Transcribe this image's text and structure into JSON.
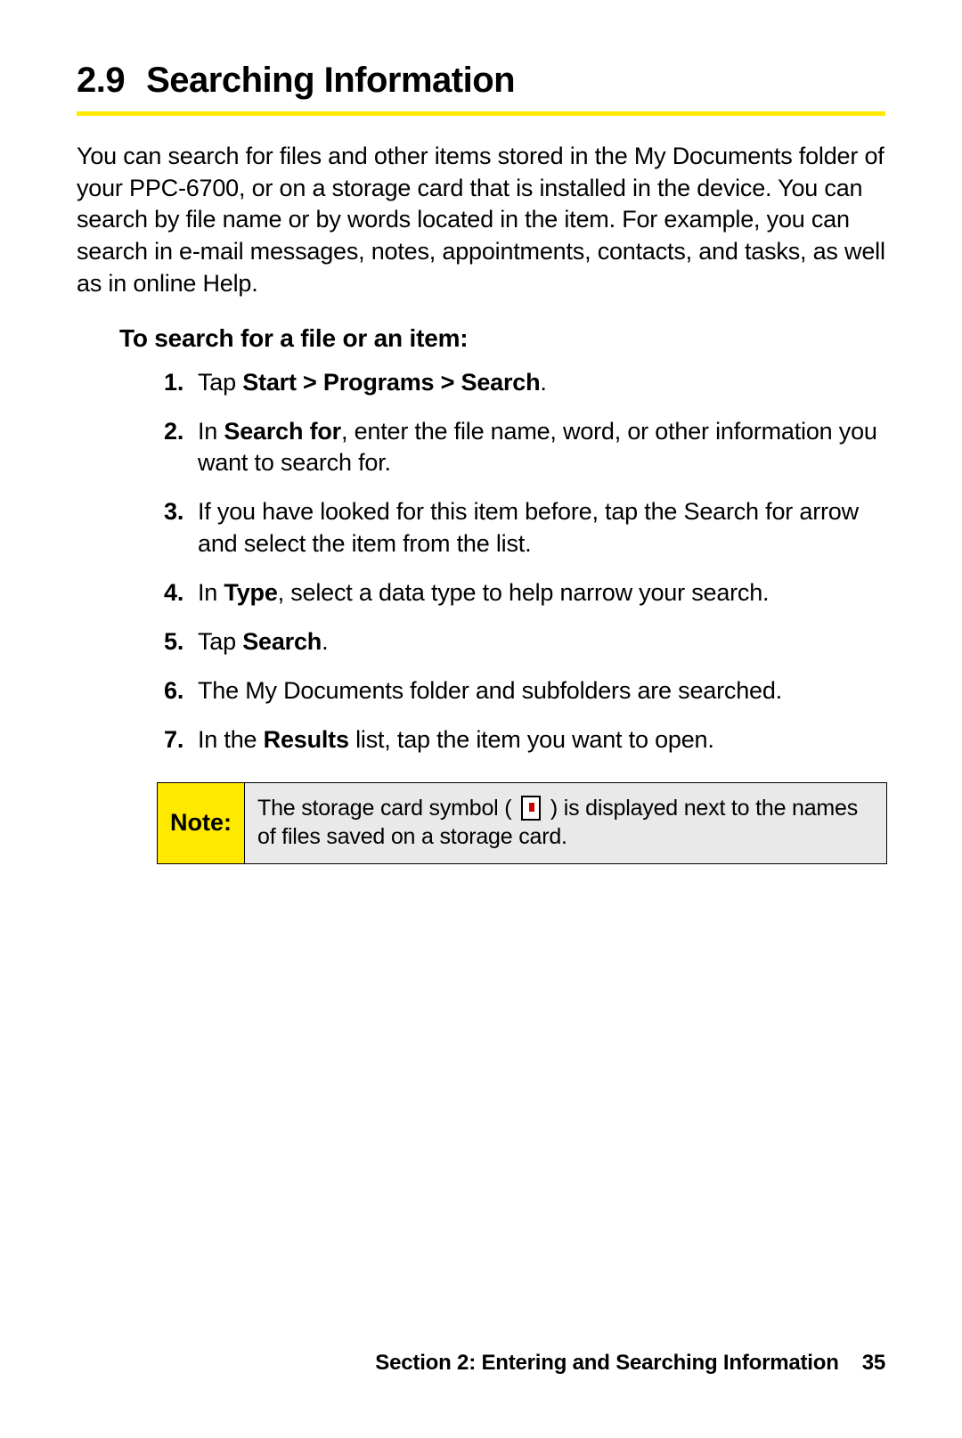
{
  "heading": {
    "number": "2.9",
    "title": "Searching Information"
  },
  "intro": "You can search for files and other items stored in the My Documents folder of your PPC-6700, or on a storage card that is installed in the device. You can search by file name or by words located in the item. For example, you can search in e-mail messages, notes, appointments, contacts, and tasks, as well as in online Help.",
  "subheading": "To search for a file or an item:",
  "steps": {
    "s1_pre": "Tap ",
    "s1_bold": "Start > Programs > Search",
    "s1_post": ".",
    "s2_pre": "In ",
    "s2_bold": "Search for",
    "s2_post": ", enter the file name, word, or other information you want to search for.",
    "s3": "If you have looked for this item before, tap the Search for arrow and select the item from the list.",
    "s4_pre": "In ",
    "s4_bold": "Type",
    "s4_post": ", select a data type to help narrow your search.",
    "s5_pre": "Tap ",
    "s5_bold": "Search",
    "s5_post": ".",
    "s6": "The My Documents folder and subfolders are searched.",
    "s7_pre": "In the ",
    "s7_bold": "Results",
    "s7_post": " list, tap the item you want to open."
  },
  "note": {
    "label": "Note:",
    "text_pre": "The storage card symbol ( ",
    "text_post": " ) is displayed next to the names of files saved on a storage card."
  },
  "footer": {
    "section": "Section 2: Entering and Searching Information",
    "page": "35"
  }
}
